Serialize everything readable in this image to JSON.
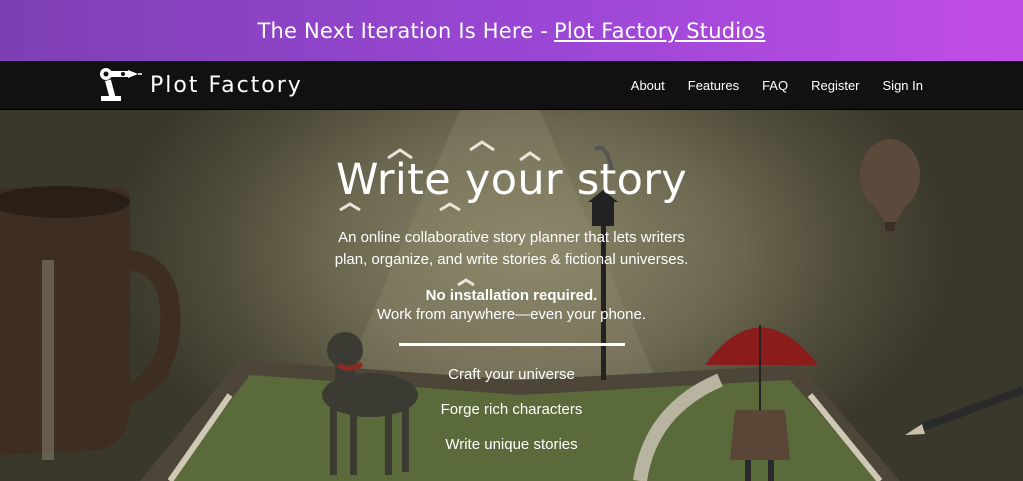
{
  "banner": {
    "text": "The Next Iteration Is Here -",
    "link": "Plot Factory Studios"
  },
  "nav": {
    "brand": "Plot Factory",
    "links": [
      "About",
      "Features",
      "FAQ",
      "Register",
      "Sign In"
    ]
  },
  "hero": {
    "title": "Write your story",
    "description": "An online collaborative story planner that lets writers plan, organize, and write stories & fictional universes.",
    "strong": "No installation required.",
    "sub": "Work from anywhere—even your phone.",
    "features": [
      "Craft your universe",
      "Forge rich characters",
      "Write unique stories"
    ]
  },
  "colors": {
    "banner_start": "#7e3fb3",
    "banner_end": "#c24de6",
    "navbar": "#111111"
  },
  "icons": {
    "logo": "robot-arm-pen-logo"
  }
}
